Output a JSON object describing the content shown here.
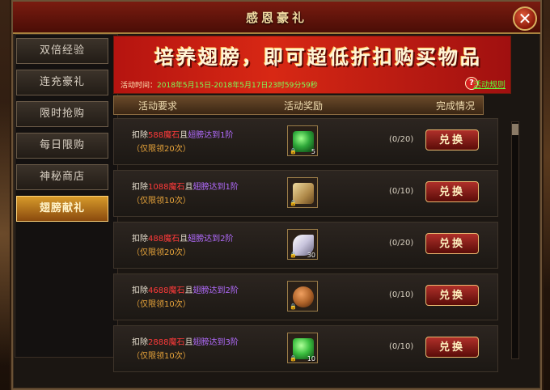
{
  "window": {
    "title": "感恩豪礼"
  },
  "sidebar": {
    "items": [
      {
        "label": "双倍经验",
        "active": false
      },
      {
        "label": "连充豪礼",
        "active": false
      },
      {
        "label": "限时抢购",
        "active": false
      },
      {
        "label": "每日限购",
        "active": false
      },
      {
        "label": "神秘商店",
        "active": false
      },
      {
        "label": "翅膀献礼",
        "active": true
      }
    ]
  },
  "banner": {
    "title": "培养翅膀，即可超低折扣购买物品",
    "time_label": "活动时间：",
    "time_value": "2018年5月15日-2018年5月17日23时59分59秒",
    "rules_label": "活动规则"
  },
  "columns": {
    "requirement": "活动要求",
    "reward": "活动奖励",
    "status": "完成情况"
  },
  "rows": [
    {
      "prefix": "扣除",
      "cost": "588魔石",
      "mid": "且",
      "cond": "翅膀达到1阶",
      "limit": "（仅限领20次）",
      "count": "5",
      "progress": "(0/20)",
      "button": "兑换",
      "icon_color": "#2ea83a"
    },
    {
      "prefix": "扣除",
      "cost": "1088魔石",
      "mid": "且",
      "cond": "翅膀达到1阶",
      "limit": "（仅限领10次）",
      "count": "",
      "progress": "(0/10)",
      "button": "兑换",
      "icon_color": "#c9a05a"
    },
    {
      "prefix": "扣除",
      "cost": "488魔石",
      "mid": "且",
      "cond": "翅膀达到2阶",
      "limit": "（仅限领20次）",
      "count": "30",
      "progress": "(0/20)",
      "button": "兑换",
      "icon_color": "#dcd8e8"
    },
    {
      "prefix": "扣除",
      "cost": "4688魔石",
      "mid": "且",
      "cond": "翅膀达到2阶",
      "limit": "（仅限领10次）",
      "count": "",
      "progress": "(0/10)",
      "button": "兑换",
      "icon_color": "#b0642a"
    },
    {
      "prefix": "扣除",
      "cost": "2888魔石",
      "mid": "且",
      "cond": "翅膀达到3阶",
      "limit": "（仅限领10次）",
      "count": "10",
      "progress": "(0/10)",
      "button": "兑换",
      "icon_color": "#3cc040"
    }
  ]
}
